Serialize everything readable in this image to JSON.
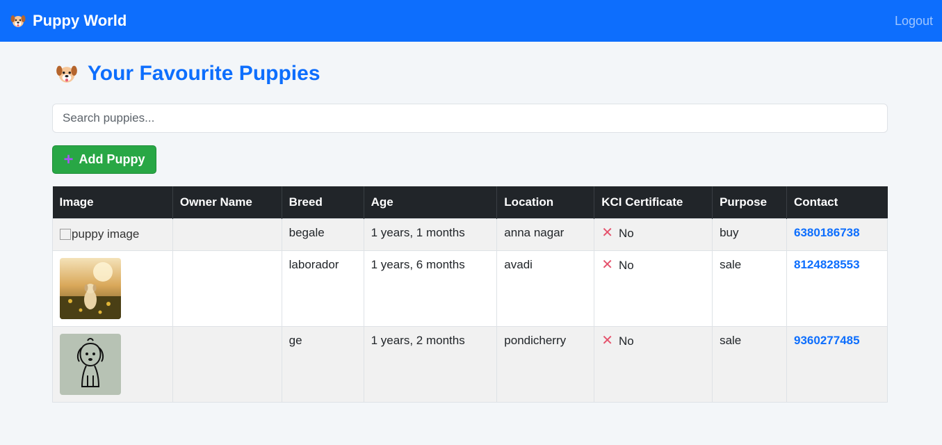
{
  "navbar": {
    "brand": "Puppy World",
    "brand_icon": "dog-face-icon",
    "logout": "Logout"
  },
  "page": {
    "title": "Your Favourite Puppies",
    "title_icon": "dog-face-icon"
  },
  "search": {
    "placeholder": "Search puppies...",
    "value": ""
  },
  "add_button": {
    "label": "Add Puppy",
    "icon": "plus-icon"
  },
  "table": {
    "headers": [
      "Image",
      "Owner Name",
      "Breed",
      "Age",
      "Location",
      "KCI Certificate",
      "Purpose",
      "Contact"
    ],
    "rows": [
      {
        "image_alt": "puppy image",
        "owner": "",
        "breed": "begale",
        "age": "1 years, 1 months",
        "location": "anna nagar",
        "kci": "No",
        "purpose": "buy",
        "contact": "6380186738"
      },
      {
        "image_alt": "",
        "owner": "",
        "breed": "laborador",
        "age": "1 years, 6 months",
        "location": "avadi",
        "kci": "No",
        "purpose": "sale",
        "contact": "8124828553"
      },
      {
        "image_alt": "",
        "owner": "",
        "breed": "ge",
        "age": "1 years, 2 months",
        "location": "pondicherry",
        "kci": "No",
        "purpose": "sale",
        "contact": "9360277485"
      }
    ]
  },
  "colors": {
    "primary": "#0d6efd",
    "success": "#28a745",
    "dark": "#212529",
    "cross": "#e5526c"
  }
}
